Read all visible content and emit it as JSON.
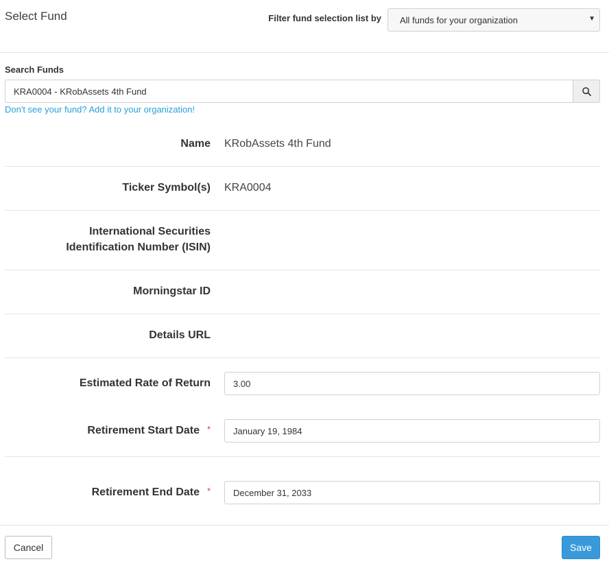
{
  "header": {
    "title": "Select Fund",
    "filter_label": "Filter fund selection list by",
    "filter_value": "All funds for your organization"
  },
  "search": {
    "label": "Search Funds",
    "value": "KRA0004 - KRobAssets 4th Fund",
    "add_link": "Don't see your fund? Add it to your organization!"
  },
  "details": {
    "name_label": "Name",
    "name_value": "KRobAssets 4th Fund",
    "ticker_label": "Ticker Symbol(s)",
    "ticker_value": "KRA0004",
    "isin_label_line1": "International Securities",
    "isin_label_line2": "Identification Number (ISIN)",
    "morningstar_label": "Morningstar ID",
    "details_url_label": "Details URL"
  },
  "form": {
    "rate_label": "Estimated Rate of Return",
    "rate_value": "3.00",
    "start_label": "Retirement Start Date",
    "start_value": "January 19, 1984",
    "end_label": "Retirement End Date",
    "end_value": "December 31, 2033",
    "required_marker": "*"
  },
  "footer": {
    "cancel_label": "Cancel",
    "save_label": "Save"
  }
}
